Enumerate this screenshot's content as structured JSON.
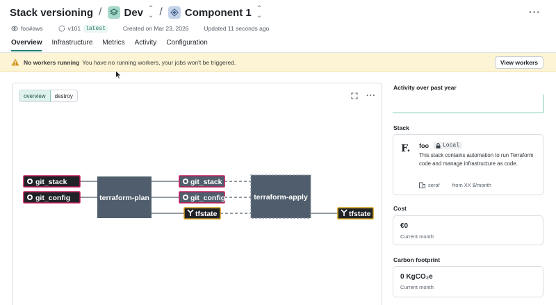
{
  "breadcrumb": {
    "items": [
      {
        "label": "Stack versioning"
      },
      {
        "label": "Dev"
      },
      {
        "label": "Component 1"
      }
    ],
    "separator": "/"
  },
  "meta": {
    "owner": "foo#aws",
    "version": "v101",
    "version_tag": "latest",
    "created": "Created on Mar 23, 2026",
    "updated": "Updated 11 seconds ago"
  },
  "tabs": [
    "Overview",
    "Infrastructure",
    "Metrics",
    "Activity",
    "Configuration"
  ],
  "banner": {
    "title": "No workers running",
    "message": "You have no running workers, your jobs won't be triggered.",
    "button": "View workers"
  },
  "canvas": {
    "toggle": [
      "overview",
      "destroy"
    ],
    "nodes": {
      "git_stack_1": "git_stack",
      "git_config_1": "git_config",
      "plan": "terraform-plan",
      "git_stack_2": "git_stack",
      "git_config_2": "git_config",
      "tfstate_1": "tfstate",
      "apply": "terraform-apply",
      "tfstate_2": "tfstate"
    }
  },
  "activity": {
    "title": "Activity over past year"
  },
  "stack": {
    "title": "Stack",
    "logo": "F.",
    "name": "foo",
    "badge": "Local",
    "description": "This stack contains automation to run Terraform code and manage infrastructure as code.",
    "owner": "seraf",
    "price": "from XX $/month"
  },
  "cost": {
    "title": "Cost",
    "value": "€0",
    "period": "Current month"
  },
  "carbon": {
    "title": "Carbon footprint",
    "value": "0 KgCO₂e",
    "period": "Current month"
  },
  "colors": {
    "accent": "#1f7d6b",
    "node": "#4f5d6c",
    "gitBorder": "#c2185b",
    "tfBorder": "#d4a017"
  }
}
